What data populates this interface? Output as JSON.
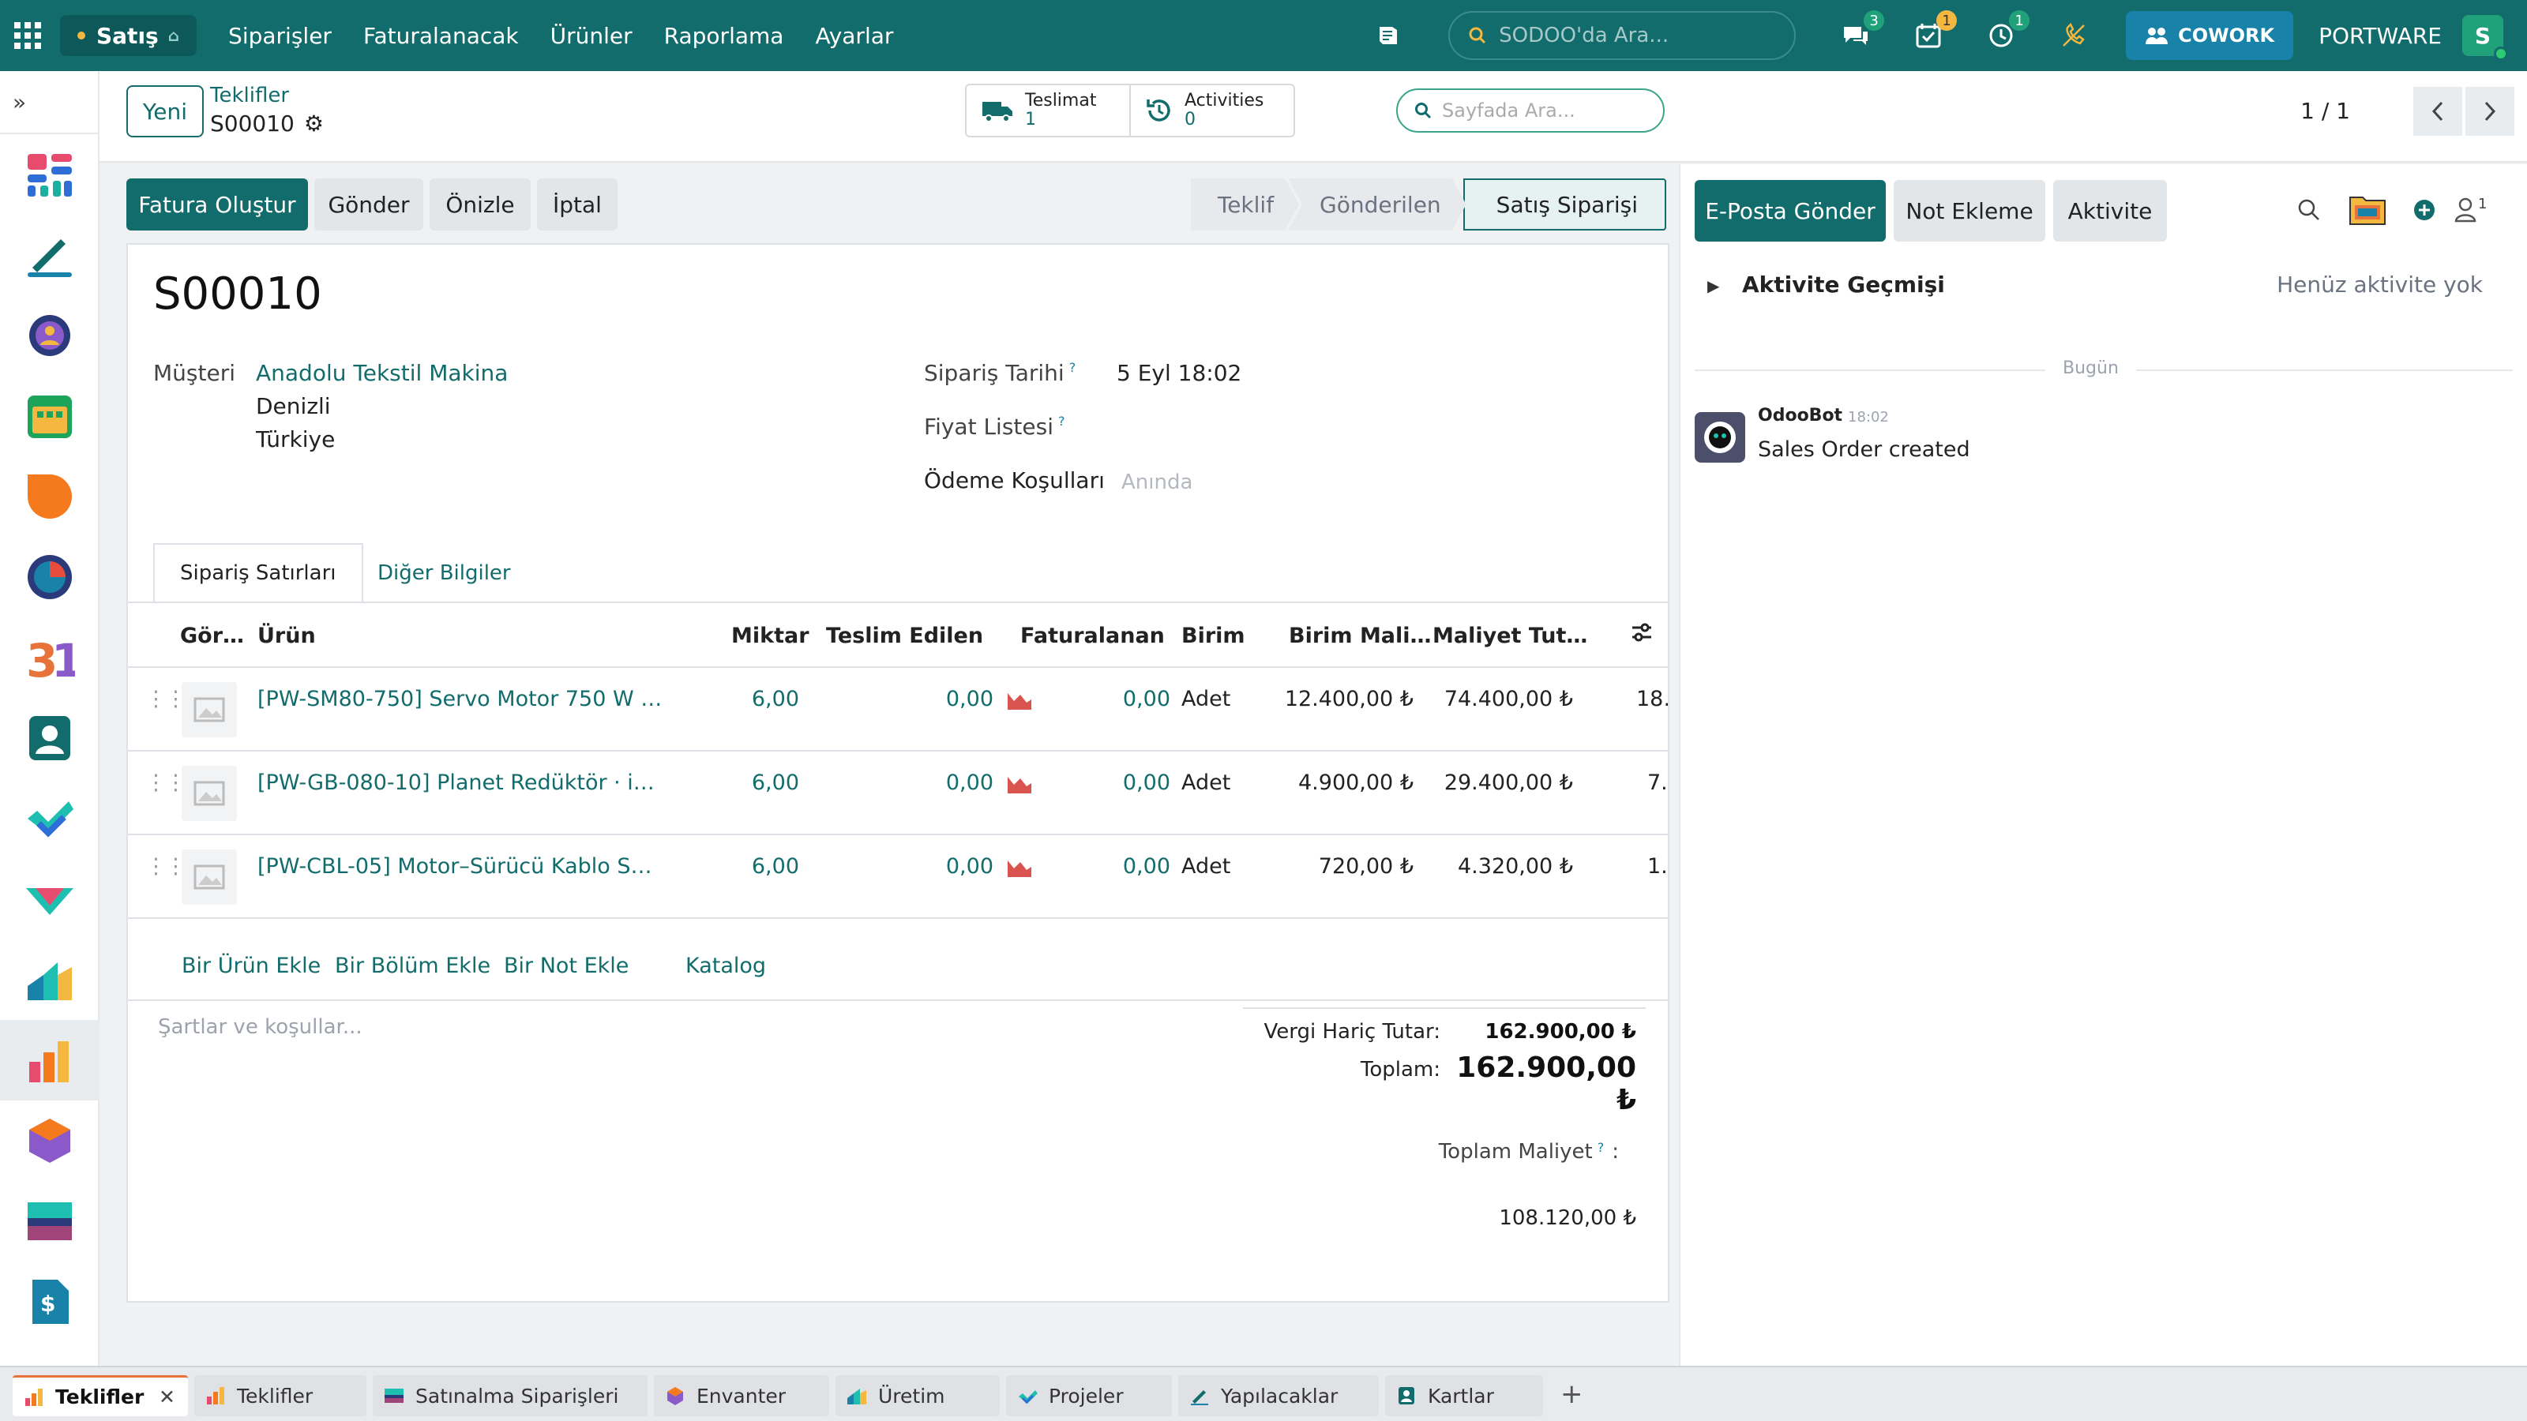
{
  "navbar": {
    "app_name": "Satış",
    "menu": [
      "Siparişler",
      "Faturalanacak",
      "Ürünler",
      "Raporlama",
      "Ayarlar"
    ],
    "search_placeholder": "SODOO'da Ara...",
    "messages_count": "3",
    "activities_count": "1",
    "timer_count": "1",
    "cowork_label": "COWORK",
    "company": "PORTWARE",
    "user_initial": "S"
  },
  "control_panel": {
    "new_button": "Yeni",
    "breadcrumb_parent": "Teklifler",
    "breadcrumb_current": "S00010",
    "smart_buttons": [
      {
        "label": "Teslimat",
        "value": "1"
      },
      {
        "label": "Activities",
        "value": "0"
      }
    ],
    "search_placeholder": "Sayfada Ara...",
    "pager": "1 / 1"
  },
  "actions": {
    "create_invoice": "Fatura Oluştur",
    "send": "Gönder",
    "preview": "Önizle",
    "cancel": "İptal"
  },
  "stages": [
    "Teklif",
    "Gönderilen",
    "Satış Siparişi"
  ],
  "form": {
    "name": "S00010",
    "customer_label": "Müşteri",
    "customer_name": "Anadolu Tekstil Makina",
    "customer_city": "Denizli",
    "customer_country": "Türkiye",
    "order_date_label": "Sipariş Tarihi",
    "order_date": "5 Eyl 18:02",
    "pricelist_label": "Fiyat Listesi",
    "payment_terms_label": "Ödeme Koşulları",
    "payment_terms_placeholder": "Anında",
    "help_mark": "?"
  },
  "tabs": [
    "Sipariş Satırları",
    "Diğer Bilgiler"
  ],
  "table": {
    "headers": [
      "Gör…",
      "Ürün",
      "Miktar",
      "Teslim Edilen",
      "Faturalanan",
      "Birim",
      "Birim Mali…",
      "Maliyet Tut…"
    ],
    "rows": [
      {
        "product": "[PW-SM80-750] Servo Motor 750 W …",
        "qty": "6,00",
        "delivered": "0,00",
        "invoiced": "0,00",
        "uom": "Adet",
        "unit_cost": "12.400,00 ₺",
        "cost_total": "74.400,00 ₺",
        "extra": "18…"
      },
      {
        "product": "[PW-GB-080-10] Planet Redüktör · i…",
        "qty": "6,00",
        "delivered": "0,00",
        "invoiced": "0,00",
        "uom": "Adet",
        "unit_cost": "4.900,00 ₺",
        "cost_total": "29.400,00 ₺",
        "extra": "7.…"
      },
      {
        "product": "[PW-CBL-05] Motor–Sürücü Kablo S…",
        "qty": "6,00",
        "delivered": "0,00",
        "invoiced": "0,00",
        "uom": "Adet",
        "unit_cost": "720,00 ₺",
        "cost_total": "4.320,00 ₺",
        "extra": "1.…"
      }
    ],
    "add_product": "Bir Ürün Ekle",
    "add_section": "Bir Bölüm Ekle",
    "add_note": "Bir Not Ekle",
    "catalog": "Katalog"
  },
  "terms_placeholder": "Şartlar ve koşullar...",
  "totals": {
    "untaxed_label": "Vergi Hariç Tutar:",
    "untaxed_value": "162.900,00 ₺",
    "total_label": "Toplam:",
    "total_value": "162.900,00 ₺",
    "cost_total_label": "Toplam Maliyet",
    "cost_total_value": "108.120,00 ₺"
  },
  "chatter": {
    "send_email": "E-Posta Gönder",
    "log_note": "Not Ekleme",
    "activity": "Aktivite",
    "followers_count": "1",
    "activity_history": "Aktivite Geçmişi",
    "no_activity": "Henüz aktivite yok",
    "today": "Bugün",
    "message_author": "OdooBot",
    "message_time": "18:02",
    "message_body": "Sales Order created"
  },
  "taskbar": [
    "Teklifler",
    "Teklifler",
    "Satınalma Siparişleri",
    "Envanter",
    "Üretim",
    "Projeler",
    "Yapılacaklar",
    "Kartlar"
  ],
  "colors": {
    "brand": "#136c6c",
    "link": "#136c6c",
    "badge_green": "#21a179",
    "badge_yellow": "#f4b740",
    "cowork": "#1982a8",
    "forecast_icon": "#d9534f"
  }
}
